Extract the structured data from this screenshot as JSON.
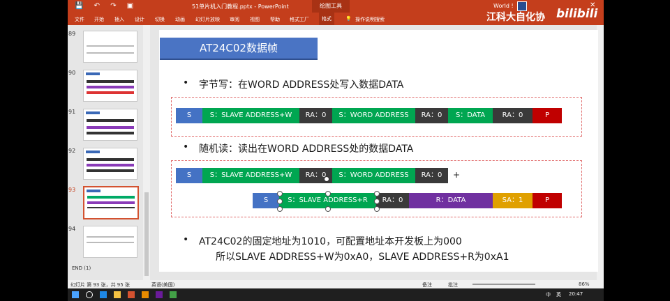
{
  "app": {
    "filename": "51单片机入门教程.pptx",
    "app_name": "PowerPoint",
    "title_separator": " - ",
    "context_tab": "绘图工具",
    "account": "World !",
    "close_glyph": "✕",
    "quick_access": "💾 ↶ ↷ ▣"
  },
  "watermark": {
    "org": "江科大自化协",
    "logo": "bilibili"
  },
  "ribbon_tabs": [
    "文件",
    "开始",
    "插入",
    "设计",
    "切换",
    "动画",
    "幻灯片放映",
    "审阅",
    "视图",
    "帮助",
    "格式工厂",
    "格式"
  ],
  "ribbon_search": "操作说明搜索",
  "thumbnails": [
    {
      "num": "89"
    },
    {
      "num": "90"
    },
    {
      "num": "91"
    },
    {
      "num": "92"
    },
    {
      "num": "93"
    },
    {
      "num": "94"
    }
  ],
  "end_label": "END (1)",
  "slide": {
    "title": "AT24C02数据帧",
    "bullet1": "字节写：在WORD ADDRESS处写入数据DATA",
    "bullet2": "随机读：读出在WORD ADDRESS处的数据DATA",
    "bullet3": "AT24C02的固定地址为1010，可配置地址本开发板上为000",
    "bullet3b": "所以SLAVE ADDRESS+W为0xA0，SLAVE ADDRESS+R为0xA1",
    "bullet_glyph": "•",
    "plus": "+",
    "row1": [
      "S",
      "S：SLAVE ADDRESS+W",
      "RA：0",
      "S：WORD ADDRESS",
      "RA：0",
      "S：DATA",
      "RA：0",
      "P"
    ],
    "row2": [
      "S",
      "S：SLAVE ADDRESS+W",
      "RA：0",
      "S：WORD ADDRESS",
      "RA：0"
    ],
    "row3": [
      "S",
      "S：SLAVE ADDRESS+R",
      "RA：0",
      "R：DATA",
      "SA：1",
      "P"
    ]
  },
  "colors": {
    "S": "#4472c4",
    "green": "#00a651",
    "RA": "#3a3a3a",
    "P": "#c00000",
    "R": "#7030a0",
    "SA": "#e0a000",
    "brand": "#c43e1c"
  },
  "status": {
    "slide_info": "幻灯片 第 93 张，共 95 张",
    "lang": "英语(美国)",
    "notes": "备注",
    "comments": "批注",
    "zoom": "86%"
  },
  "taskbar": {
    "time": "20:47",
    "ime": "中",
    "region": "英"
  }
}
